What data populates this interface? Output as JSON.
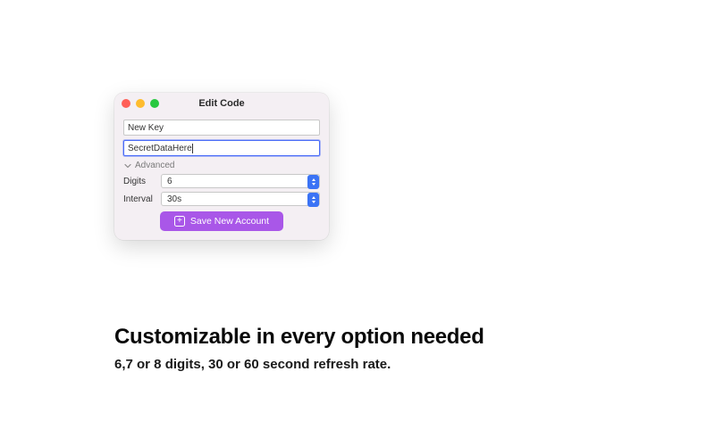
{
  "window": {
    "title": "Edit Code",
    "fields": {
      "name": "New Key",
      "secret": "SecretDataHere"
    },
    "advanced": {
      "label": "Advanced",
      "digits": {
        "label": "Digits",
        "value": "6"
      },
      "interval": {
        "label": "Interval",
        "value": "30s"
      }
    },
    "save_label": "Save New Account"
  },
  "caption": {
    "title": "Customizable in every option needed",
    "sub": "6,7 or 8 digits, 30 or 60 second refresh rate."
  }
}
